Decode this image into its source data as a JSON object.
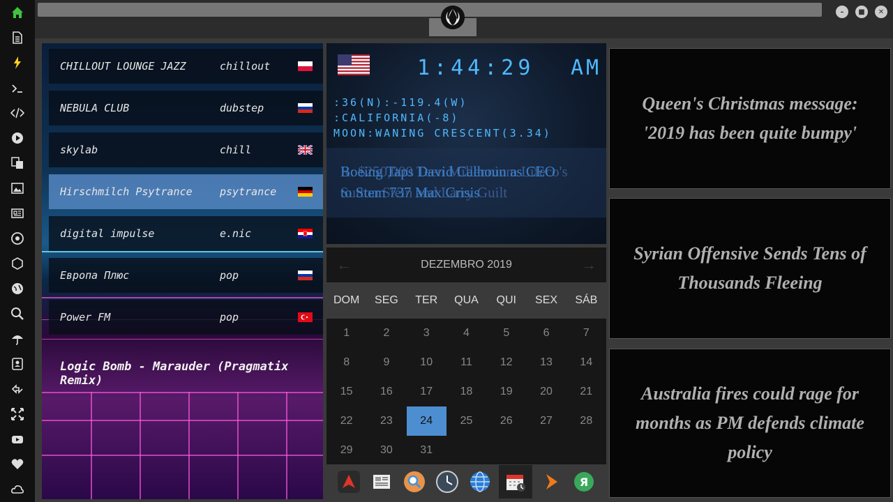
{
  "sidebar": {
    "icons": [
      "home-icon",
      "document-icon",
      "lightning-icon",
      "terminal-icon",
      "code-icon",
      "play-icon",
      "translate-icon",
      "image-icon",
      "news-icon",
      "empire-icon",
      "hexagon-icon",
      "globe-icon",
      "search-icon",
      "umbrella-icon",
      "contacts-icon",
      "transfer-icon",
      "expand-icon",
      "youtube-icon",
      "heart-icon",
      "cloud-icon"
    ]
  },
  "window": {
    "minimize_label": "–",
    "maximize_label": "■",
    "close_label": "✕"
  },
  "radio": {
    "stations": [
      {
        "name": "CHILLOUT LOUNGE JAZZ",
        "genre": "chillout",
        "flag": "pl"
      },
      {
        "name": "NEBULA CLUB",
        "genre": "dubstep",
        "flag": "ru"
      },
      {
        "name": "skylab",
        "genre": "chill",
        "flag": "gb"
      },
      {
        "name": "Hirschmilch Psytrance",
        "genre": "psytrance",
        "flag": "de"
      },
      {
        "name": "digital impulse",
        "genre": "e.nic",
        "flag": "hr"
      },
      {
        "name": "Европа Плюс",
        "genre": "pop",
        "flag": "ru"
      },
      {
        "name": "Power FM",
        "genre": "pop",
        "flag": "tr"
      }
    ],
    "now_playing": "Logic Bomb - Marauder (Pragmatix Remix)"
  },
  "clock": {
    "time": "1:44:29",
    "ampm": "AM",
    "coords": ":36(N):-119.4(W)",
    "region": ":CALIFORNIA(-8)",
    "moon": "MOON:WANING CRESCENT(3.34)",
    "ticker_a1": "Boeing Taps David Calhoun as CEO",
    "ticker_a2": "to Stem 737 Max Crisis",
    "ticker_b1": "R: $250,000 Teen Millennium Lifeco's",
    "ticker_b2": "Sutton Stein and Larry Guilt"
  },
  "calendar": {
    "month_label": "DEZEMBRO 2019",
    "prev": "←",
    "next": "→",
    "weekdays": [
      "DOM",
      "SEG",
      "TER",
      "QUA",
      "QUI",
      "SEX",
      "SÁB"
    ],
    "weeks": [
      [
        "1",
        "2",
        "3",
        "4",
        "5",
        "6",
        "7"
      ],
      [
        "8",
        "9",
        "10",
        "11",
        "12",
        "13",
        "14"
      ],
      [
        "15",
        "16",
        "17",
        "18",
        "19",
        "20",
        "21"
      ],
      [
        "22",
        "23",
        "24",
        "25",
        "26",
        "27",
        "28"
      ],
      [
        "29",
        "30",
        "31",
        "",
        "",
        "",
        ""
      ]
    ],
    "today": "24"
  },
  "dock": {
    "items": [
      "archlinux-icon",
      "news-reader-icon",
      "search-app-icon",
      "clock-app-icon",
      "browser-globe-icon",
      "calendar-app-icon",
      "arrow-app-icon",
      "yandex-icon"
    ],
    "active": "calendar-app-icon"
  },
  "headlines": [
    "Queen's Christmas message: '2019 has been quite bumpy'",
    "Syrian Offensive Sends Tens of Thousands Fleeing",
    "Australia fires could rage for months as PM defends climate policy"
  ],
  "colors": {
    "clock_accent": "#4fb9ff",
    "selected_station": "#5a8cc8",
    "today_highlight": "#4d8ed1",
    "headline_text": "#b0b0b0"
  }
}
